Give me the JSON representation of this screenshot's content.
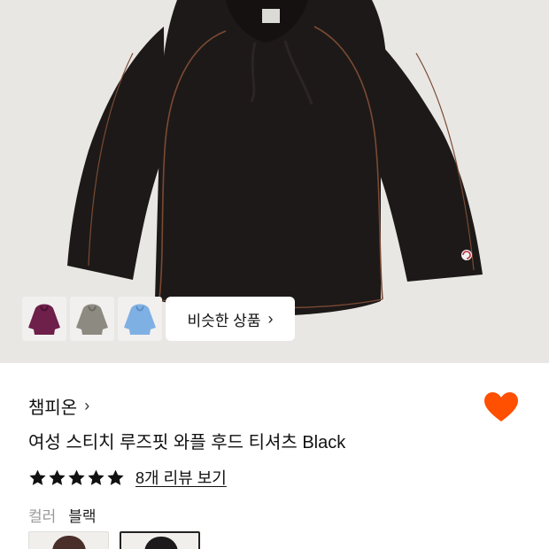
{
  "product": {
    "brand": "챔피온",
    "title": "여성 스티치 루즈핏 와플 후드 티셔츠 Black",
    "rating_stars": 5,
    "review_link": "8개 리뷰 보기",
    "color_label": "컬러",
    "color_value": "블랙"
  },
  "gallery": {
    "similar_button_label": "비슷한 상품",
    "thumbnails": [
      {
        "name": "thumb-purple",
        "color": "#6e1f4a"
      },
      {
        "name": "thumb-gray",
        "color": "#8d8a82"
      },
      {
        "name": "thumb-lightblue",
        "color": "#7fb0e3"
      }
    ]
  },
  "swatches": [
    {
      "color": "#4a2e2a",
      "selected": false
    },
    {
      "color": "#1c1a1a",
      "selected": true
    }
  ],
  "colors": {
    "accent_heart": "#ff4f00",
    "hero_bg": "#e9e7e4",
    "hoodie": "#1d1918",
    "stitch": "#7a4a33"
  },
  "icons": {
    "favorite": "heart-icon",
    "star": "star-icon",
    "chevron": "chevron-right-icon"
  }
}
